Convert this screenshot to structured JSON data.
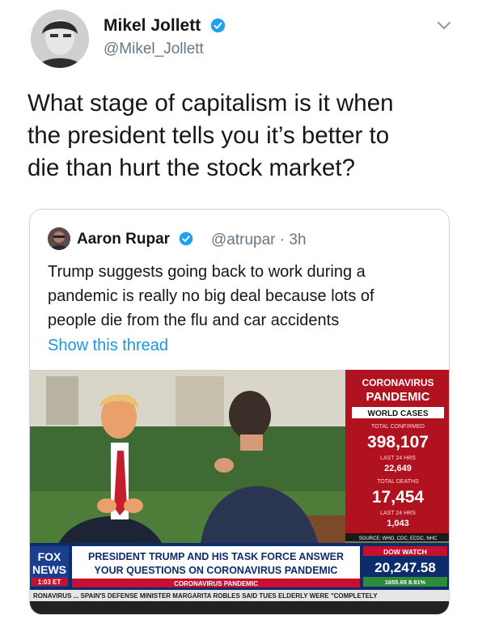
{
  "tweet": {
    "author_name": "Mikel Jollett",
    "author_handle": "@Mikel_Jollett",
    "text_lines": [
      "What stage of capitalism is it when",
      "the president tells you it’s better to",
      "die than hurt the stock market?"
    ],
    "icons": {
      "verified": "verified-badge-icon",
      "menu": "chevron-down-icon"
    }
  },
  "quote": {
    "author_name": "Aaron Rupar",
    "author_handle": "@atrupar · 3h",
    "text_lines": [
      "Trump suggests going back to work during a",
      "pandemic is really no big deal because lots of",
      "people die from the flu and car accidents"
    ],
    "show_thread": "Show this thread"
  },
  "video": {
    "panel_title_1": "CORONAVIRUS",
    "panel_title_2": "PANDEMIC",
    "world_cases": "WORLD CASES",
    "total_confirmed_label": "TOTAL CONFIRMED",
    "total_confirmed": "398,107",
    "last24_label_1": "LAST 24 HRS",
    "last24_confirmed": "22,649",
    "total_deaths_label": "TOTAL DEATHS",
    "total_deaths": "17,454",
    "last24_label_2": "LAST 24 HRS",
    "last24_deaths": "1,043",
    "source": "SOURCE: WHO, CDC, ECDC, NHC",
    "headline_1": "PRESIDENT TRUMP AND HIS TASK FORCE ANSWER",
    "headline_2": "YOUR QUESTIONS ON CORONAVIRUS PANDEMIC",
    "subheadline": "CORONAVIRUS PANDEMIC",
    "logo_line1": "FOX",
    "logo_line2": "NEWS",
    "time": "1:03 ET",
    "dow_label": "DOW WATCH",
    "dow_value": "20,247.58",
    "dow_change": "1655.65  8.91%",
    "crawl": "RONAVIRUS ... SPAIN'S DEFENSE MINISTER MARGARITA ROBLES SAID TUES ELDERLY WERE \"COMPLETELY"
  },
  "colors": {
    "text": "#14171a",
    "muted": "#657786",
    "link": "#1b95e0",
    "verified": "#1da1f2",
    "fox_red": "#c8102e",
    "fox_blue": "#0d2c6c"
  }
}
